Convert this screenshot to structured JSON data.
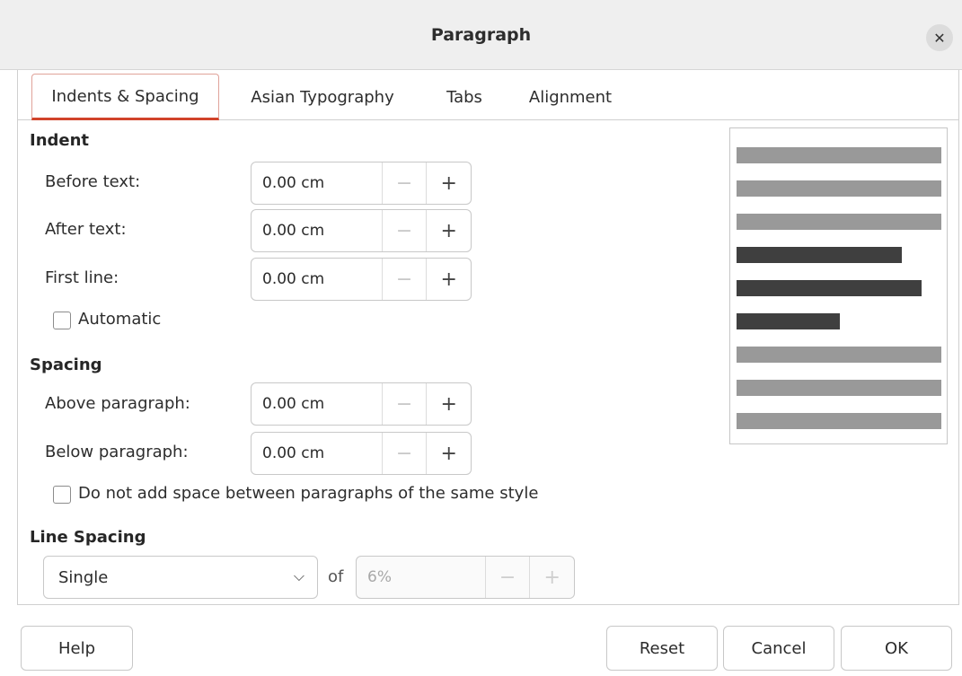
{
  "dialog": {
    "title": "Paragraph",
    "close_icon": "close-icon"
  },
  "tabs": [
    {
      "label": "Indents & Spacing",
      "active": true
    },
    {
      "label": "Asian Typography",
      "active": false
    },
    {
      "label": "Tabs",
      "active": false
    },
    {
      "label": "Alignment",
      "active": false
    }
  ],
  "indent": {
    "heading": "Indent",
    "before_text": {
      "label": "Before text:",
      "value": "0.00 cm"
    },
    "after_text": {
      "label": "After text:",
      "value": "0.00 cm"
    },
    "first_line": {
      "label": "First line:",
      "value": "0.00 cm"
    },
    "automatic": {
      "label": "Automatic",
      "checked": false
    }
  },
  "spacing": {
    "heading": "Spacing",
    "above": {
      "label": "Above paragraph:",
      "value": "0.00 cm"
    },
    "below": {
      "label": "Below paragraph:",
      "value": "0.00 cm"
    },
    "no_space_same_style": {
      "label": "Do not add space between paragraphs of the same style",
      "checked": false
    }
  },
  "line_spacing": {
    "heading": "Line Spacing",
    "mode": "Single",
    "of_label": "of",
    "of_value": "6%"
  },
  "spin_symbols": {
    "minus": "−",
    "plus": "+"
  },
  "footer": {
    "help": "Help",
    "reset": "Reset",
    "cancel": "Cancel",
    "ok": "OK"
  },
  "colors": {
    "accent": "#d1432a",
    "preview_light": "#999999",
    "preview_dark": "#3f3f3f"
  }
}
